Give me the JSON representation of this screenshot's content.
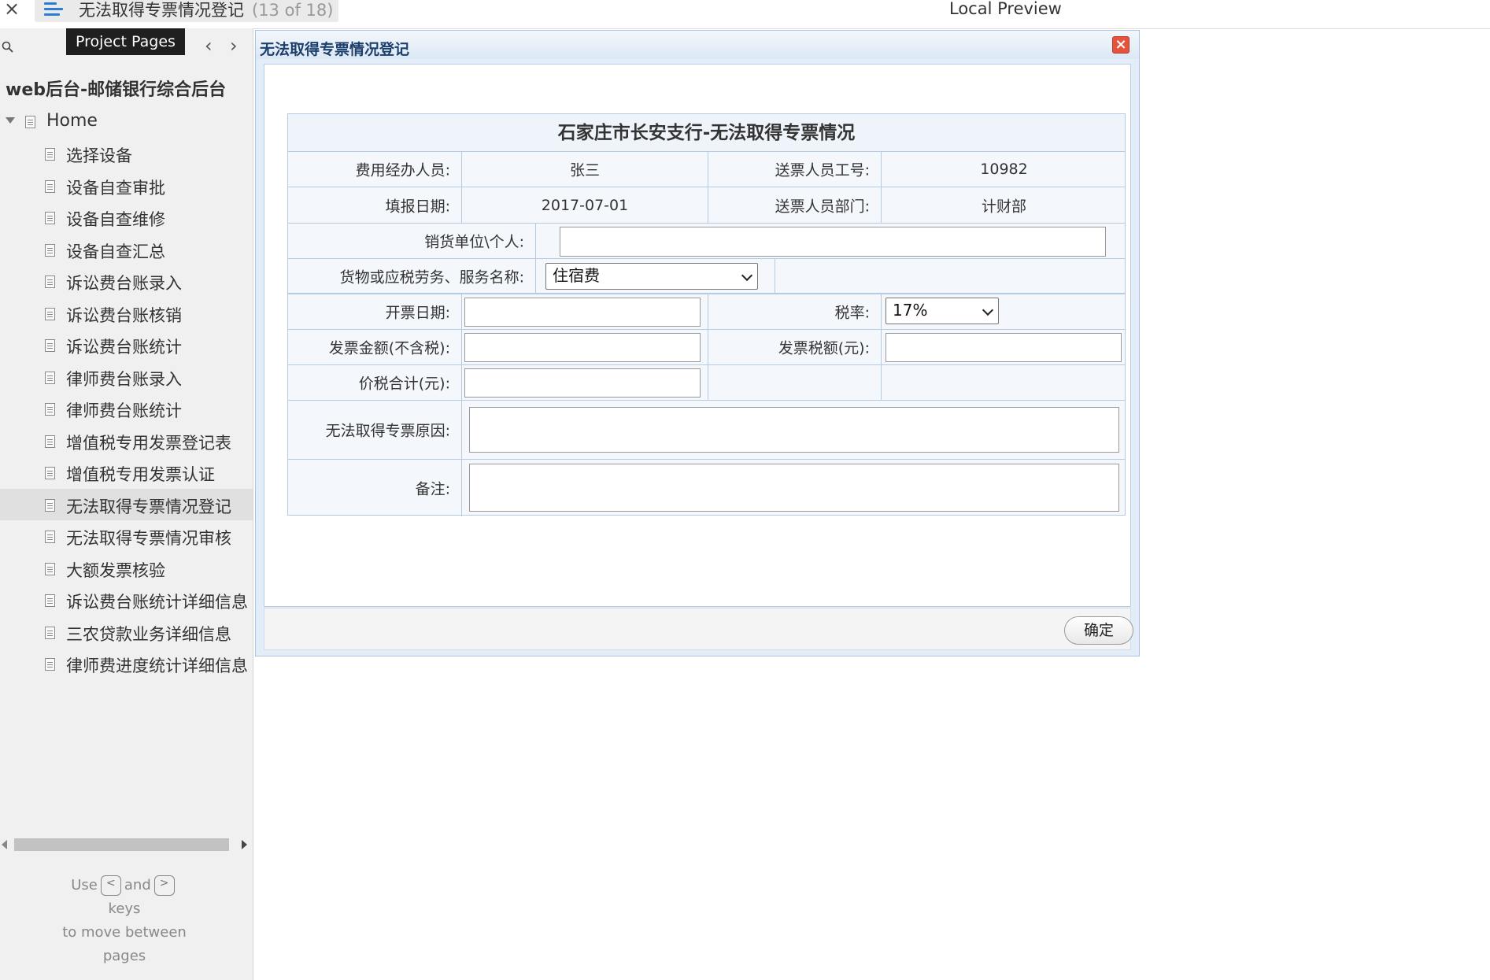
{
  "topbar": {
    "close": "×",
    "page_title": "无法取得专票情况登记",
    "page_count": "(13 of 18)",
    "preview_label": "Local Preview"
  },
  "sidebar": {
    "tooltip": "Project Pages",
    "project_title": "web后台-邮储银行综合后台",
    "home_label": "Home",
    "items": [
      {
        "label": "选择设备"
      },
      {
        "label": "设备自查审批"
      },
      {
        "label": "设备自查维修"
      },
      {
        "label": "设备自查汇总"
      },
      {
        "label": "诉讼费台账录入"
      },
      {
        "label": "诉讼费台账核销"
      },
      {
        "label": "诉讼费台账统计"
      },
      {
        "label": "律师费台账录入"
      },
      {
        "label": "律师费台账统计"
      },
      {
        "label": "增值税专用发票登记表"
      },
      {
        "label": "增值税专用发票认证"
      },
      {
        "label": "无法取得专票情况登记"
      },
      {
        "label": "无法取得专票情况审核"
      },
      {
        "label": "大额发票核验"
      },
      {
        "label": "诉讼费台账统计详细信息"
      },
      {
        "label": "三农贷款业务详细信息"
      },
      {
        "label": "律师费进度统计详细信息"
      }
    ],
    "active_index": 11,
    "hint": {
      "use": "Use",
      "and": "and",
      "keys": "keys",
      "move": "to move between",
      "pages": "pages",
      "key_prev": "<",
      "key_next": ">"
    }
  },
  "dialog": {
    "title": "无法取得专票情况登记",
    "close": "×",
    "form_title": "石家庄市长安支行-无法取得专票情况",
    "handler_label": "费用经办人员:",
    "handler_value": "张三",
    "sender_id_label": "送票人员工号:",
    "sender_id_value": "10982",
    "fill_date_label": "填报日期:",
    "fill_date_value": "2017-07-01",
    "sender_dept_label": "送票人员部门:",
    "sender_dept_value": "计财部",
    "seller_label": "销货单位\\个人:",
    "goods_label": "货物或应税劳务、服务名称:",
    "goods_value": "住宿费",
    "invoice_date_label": "开票日期:",
    "tax_rate_label": "税率:",
    "tax_rate_value": "17%",
    "amount_label": "发票金额(不含税):",
    "tax_amount_label": "发票税额(元):",
    "total_label": "价税合计(元):",
    "reason_label": "无法取得专票原因:",
    "remark_label": "备注:",
    "ok_label": "确定"
  },
  "colors": {
    "accent": "#2a7fd4",
    "dialog_title": "#1d3f6c",
    "close_button": "#e5533d"
  }
}
